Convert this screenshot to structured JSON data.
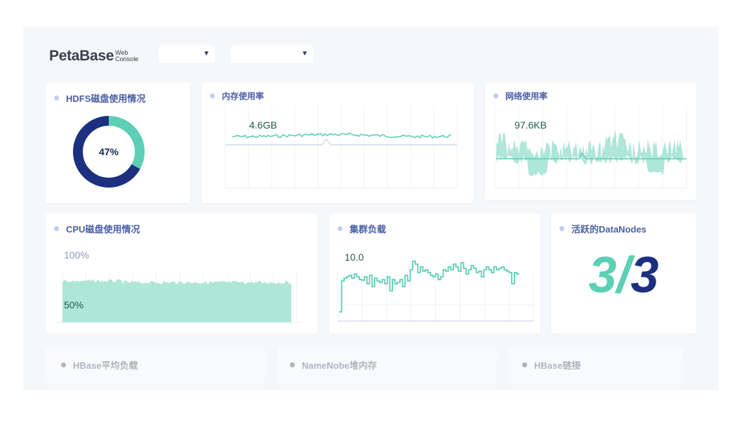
{
  "header": {
    "logo_main": "PetaBase",
    "logo_sub_top": "Web",
    "logo_sub_bottom": "Console",
    "dropdown1_value": "",
    "dropdown2_value": ""
  },
  "hdfs": {
    "title": "HDFS磁盘使用情况",
    "percent_label": "47%",
    "used_fraction": 0.67,
    "colors": {
      "used": "#1d3080",
      "rest": "#5ccfb4"
    }
  },
  "memory": {
    "title": "内存使用率",
    "value_label": "4.6GB"
  },
  "network": {
    "title": "网络使用率",
    "value_label": "97.6KB"
  },
  "cpu": {
    "title": "CPU磁盘使用情况",
    "top_label": "100%",
    "mid_label": "50%"
  },
  "cluster": {
    "title": "集群负载",
    "value_label": "10.0"
  },
  "datanodes": {
    "title": "活跃的DataNodes",
    "active": "3",
    "separator": "/",
    "total": "3",
    "colors": {
      "active": "#5ccfb4",
      "total": "#1d3080"
    }
  },
  "bottom": {
    "hbase_load_title": "HBase平均负载",
    "namenode_title": "NameNobe堆内存",
    "hbase_conn_title": "HBase链接"
  },
  "colors": {
    "accent": "#5ccfb4",
    "fill": "#aee6d8",
    "navy": "#1d3080",
    "title": "#4a5fa3"
  }
}
